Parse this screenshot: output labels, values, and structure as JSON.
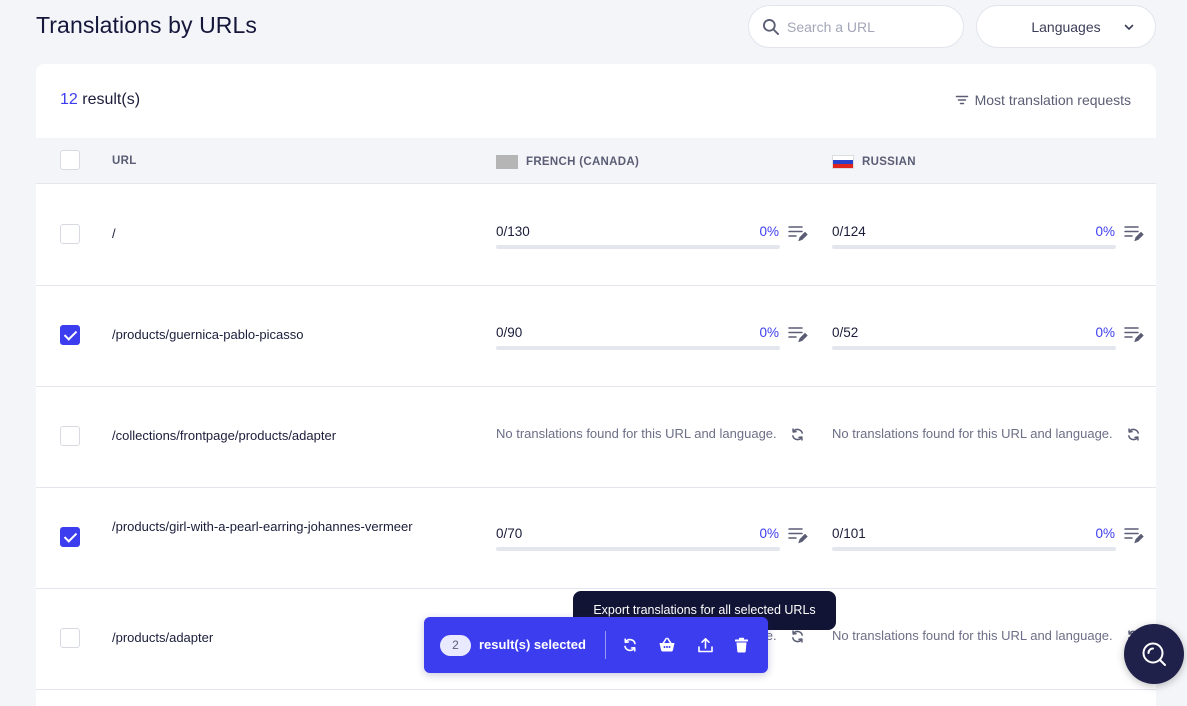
{
  "header": {
    "title": "Translations by URLs",
    "search": {
      "placeholder": "Search a URL",
      "value": ""
    },
    "languages_label": "Languages"
  },
  "results": {
    "count": "12",
    "suffix": "result(s)"
  },
  "sort": {
    "label": "Most translation requests"
  },
  "columns": {
    "url": "URL",
    "french": "FRENCH (CANADA)",
    "russian": "RUSSIAN"
  },
  "rows": [
    {
      "url": "/",
      "checked": false,
      "french": {
        "count": "0/130",
        "percent": "0%",
        "progress": 0
      },
      "russian": {
        "count": "0/124",
        "percent": "0%",
        "progress": 0
      }
    },
    {
      "url": "/products/guernica-pablo-picasso",
      "checked": true,
      "french": {
        "count": "0/90",
        "percent": "0%",
        "progress": 0
      },
      "russian": {
        "count": "0/52",
        "percent": "0%",
        "progress": 0
      }
    },
    {
      "url": "/collections/frontpage/products/adapter",
      "checked": false,
      "french": {
        "empty": "No translations found for this URL and language."
      },
      "russian": {
        "empty": "No translations found for this URL and language."
      }
    },
    {
      "url": "/products/girl-with-a-pearl-earring-johannes-vermeer",
      "checked": true,
      "french": {
        "count": "0/70",
        "percent": "0%",
        "progress": 0
      },
      "russian": {
        "count": "0/101",
        "percent": "0%",
        "progress": 0
      }
    },
    {
      "url": "/products/adapter",
      "checked": false,
      "french": {
        "empty": "No translations found for this URL and language."
      },
      "russian": {
        "empty": "No translations found for this URL and language."
      }
    }
  ],
  "selection": {
    "count": "2",
    "label": "result(s) selected"
  },
  "tooltip": {
    "text": "Export translations for all selected URLs"
  },
  "colors": {
    "accent": "#3d3df0",
    "dark": "#121436",
    "background": "#f4f5f9"
  },
  "icons": {
    "search": "search-icon",
    "chevron": "chevron-down-icon",
    "sort": "filter-icon",
    "edit": "edit-list-icon",
    "refresh": "refresh-icon",
    "basket": "basket-icon",
    "export": "export-icon",
    "delete": "trash-icon",
    "help": "help-search-icon"
  }
}
